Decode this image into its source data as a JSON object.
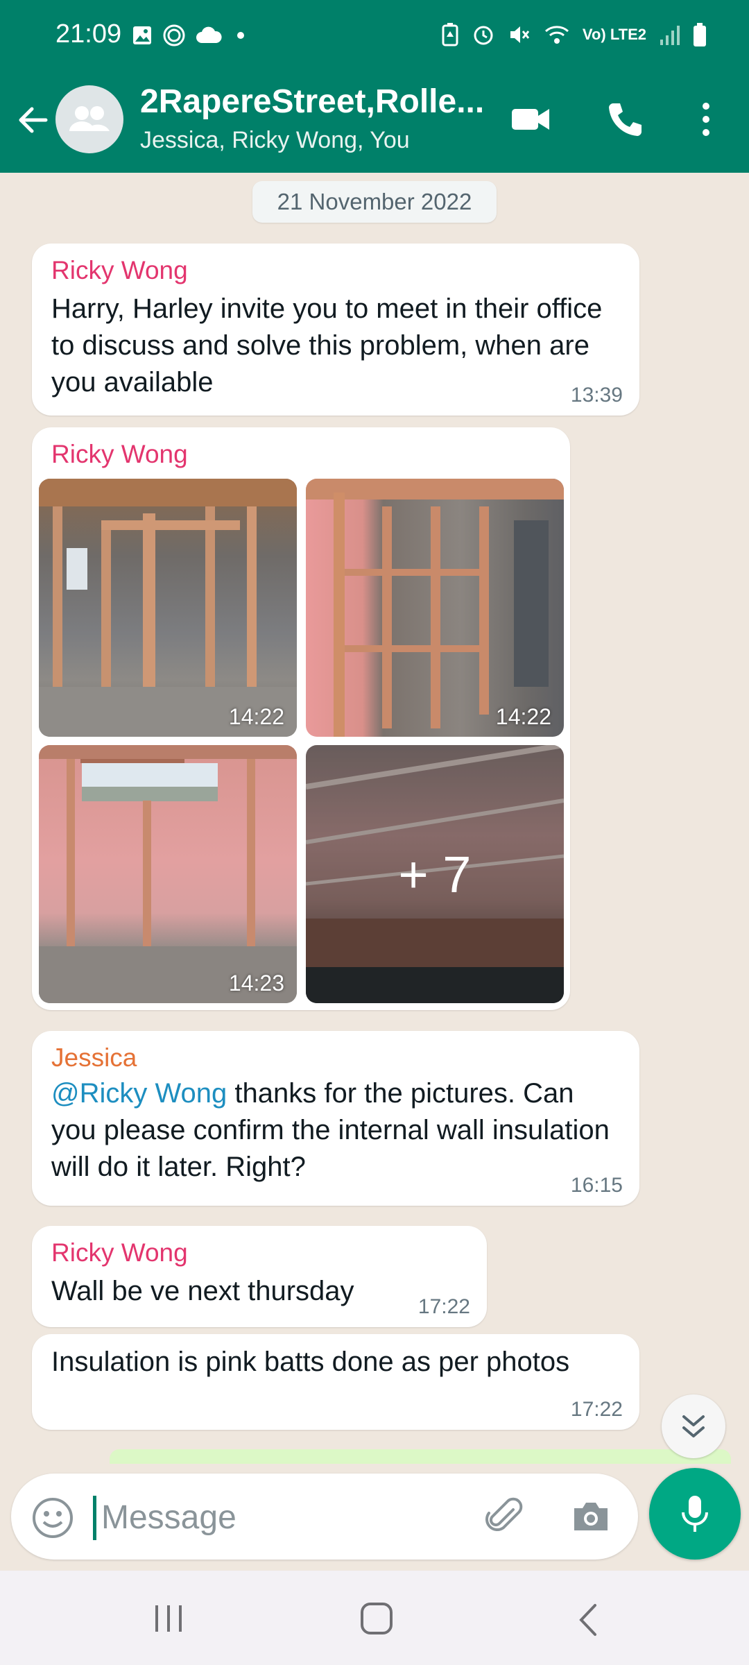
{
  "status_bar": {
    "time": "21:09",
    "network": "Vo) LTE2",
    "icons": [
      "gallery-icon",
      "signal-app-icon",
      "cloud-icon",
      "dot-icon",
      "battery-saver-icon",
      "alarm-icon",
      "mute-icon",
      "wifi-icon",
      "signal-icon",
      "battery-icon"
    ]
  },
  "header": {
    "title": "2RapereStreet,Rolle...",
    "subtitle": "Jessica, Ricky Wong, You",
    "color": "#008069"
  },
  "chat": {
    "date": "21 November 2022",
    "messages": [
      {
        "sender": "Ricky Wong",
        "text": "Harry, Harley invite you to meet in their office to discuss and solve this problem, when are you available",
        "time": "13:39"
      },
      {
        "sender": "Ricky Wong",
        "photos": [
          {
            "time": "14:22"
          },
          {
            "time": "14:22"
          },
          {
            "time": "14:23"
          },
          {
            "more": "+ 7"
          }
        ]
      },
      {
        "sender": "Jessica",
        "mention": "@Ricky Wong",
        "text": " thanks for the pictures. Can you please confirm the internal wall insulation will do it later. Right?",
        "time": "16:15"
      },
      {
        "sender": "Ricky Wong",
        "text": "Wall be ve next thursday",
        "time": "17:22"
      },
      {
        "text": "Insulation is pink batts done as per photos",
        "time": "17:22"
      }
    ]
  },
  "composer": {
    "placeholder": "Message"
  },
  "colors": {
    "ricky": "#e3356e",
    "jessica": "#e57236",
    "mention": "#1d8ec0",
    "accent": "#00a884"
  }
}
